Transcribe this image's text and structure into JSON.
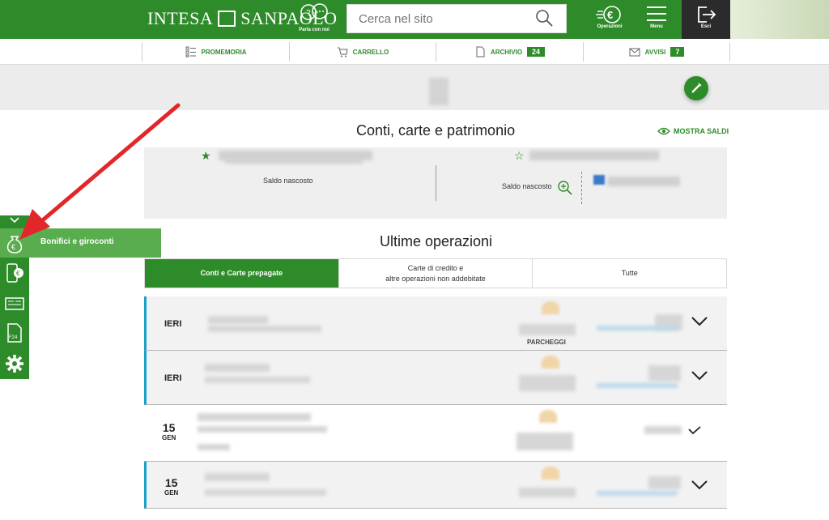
{
  "header": {
    "brand": "INTESA",
    "brand2": "SANPAOLO",
    "help_label": "Parla con noi",
    "search_placeholder": "Cerca nel sito",
    "operazioni_label": "Operazioni",
    "menu_label": "Menu",
    "esci_label": "Esci"
  },
  "subnav": {
    "items": [
      {
        "label": "PROMEMORIA",
        "icon": "checklist-icon"
      },
      {
        "label": "CARRELLO",
        "icon": "cart-icon"
      },
      {
        "label": "ARCHIVIO",
        "icon": "document-icon",
        "badge": "24"
      },
      {
        "label": "AVVISI",
        "icon": "envelope-icon",
        "badge": "7"
      }
    ]
  },
  "accounts": {
    "title": "Conti, carte e patrimonio",
    "show_balances": "MOSTRA SALDI",
    "balance_hidden_1": "Saldo nascosto",
    "balance_hidden_2": "Saldo nascosto"
  },
  "operations": {
    "title": "Ultime operazioni",
    "tabs": [
      {
        "label": "Conti e Carte prepagate"
      },
      {
        "line1": "Carte di credito e",
        "line2": "altre operazioni non addebitate"
      },
      {
        "label": "Tutte"
      }
    ],
    "rows": [
      {
        "day": "IERI",
        "month": "",
        "category": "PARCHEGGI"
      },
      {
        "day": "IERI",
        "month": "",
        "category": ""
      },
      {
        "day": "15",
        "month": "GEN",
        "category": ""
      },
      {
        "day": "15",
        "month": "GEN",
        "category": ""
      }
    ]
  },
  "sidebar": {
    "active_label": "Bonifici e giroconti"
  },
  "colors": {
    "brand_green": "#2e8b2a",
    "light_green": "#5aad4e",
    "highlight_blue": "#1aa0c8",
    "annotation_red": "#e3262a"
  }
}
